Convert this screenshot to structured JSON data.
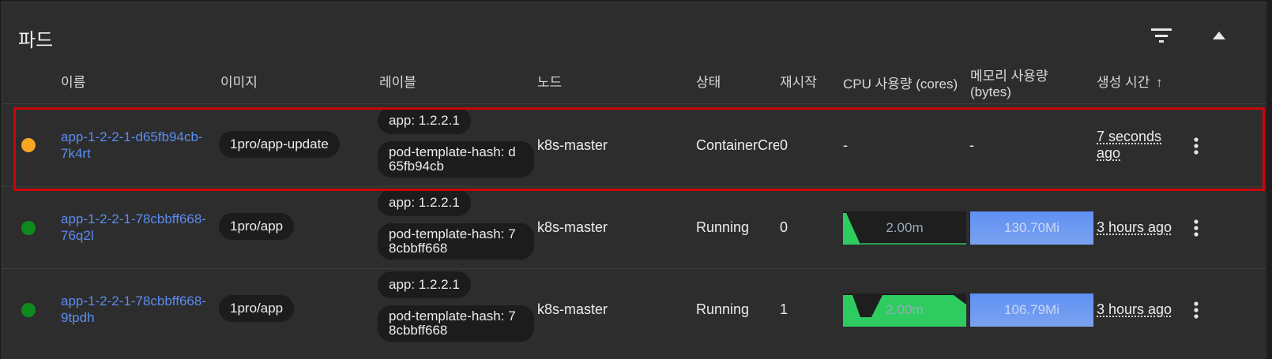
{
  "card": {
    "title": "파드"
  },
  "header": {
    "name": "이름",
    "image": "이미지",
    "labels": "레이블",
    "node": "노드",
    "status": "상태",
    "restarts": "재시작",
    "cpu": "CPU 사용량 (cores)",
    "memory_line1": "메모리 사용량",
    "memory_line2": "(bytes)",
    "created": "생성 시간",
    "created_sort_icon": "↑"
  },
  "rows": [
    {
      "status_color": "#f5a623",
      "name_line1": "app-1-2-2-1-d65fb94cb-",
      "name_line2": "7k4rt",
      "image": "1pro/app-update",
      "label_app": "app: 1.2.2.1",
      "label_hash_line1": "pod-template-hash: d",
      "label_hash_line2": "65fb94cb",
      "node": "k8s-master",
      "status": "ContainerCreating",
      "restarts": "0",
      "cpu": "-",
      "memory": "-",
      "age_line1": "7 seconds",
      "age_line2": "ago"
    },
    {
      "status_color": "#0f8a1f",
      "name_line1": "app-1-2-2-1-78cbbff668-",
      "name_line2": "76q2l",
      "image": "1pro/app",
      "label_app": "app: 1.2.2.1",
      "label_hash_line1": "pod-template-hash: 7",
      "label_hash_line2": "8cbbff668",
      "node": "k8s-master",
      "status": "Running",
      "restarts": "0",
      "cpu": "2.00m",
      "memory": "130.70Mi",
      "age": "3 hours ago"
    },
    {
      "status_color": "#0f8a1f",
      "name_line1": "app-1-2-2-1-78cbbff668-",
      "name_line2": "9tpdh",
      "image": "1pro/app",
      "label_app": "app: 1.2.2.1",
      "label_hash_line1": "pod-template-hash: 7",
      "label_hash_line2": "8cbbff668",
      "node": "k8s-master",
      "status": "Running",
      "restarts": "1",
      "cpu": "2.00m",
      "memory": "106.79Mi",
      "age": "3 hours ago"
    }
  ],
  "colors": {
    "highlight": "#c8070b",
    "link": "#5b8cf0",
    "sparkline": "#2ecc60",
    "memory": "#6a98f2"
  },
  "icons": {
    "filter": "filter-icon",
    "collapse": "chevron-up-icon",
    "menu": "more-vert-icon"
  }
}
